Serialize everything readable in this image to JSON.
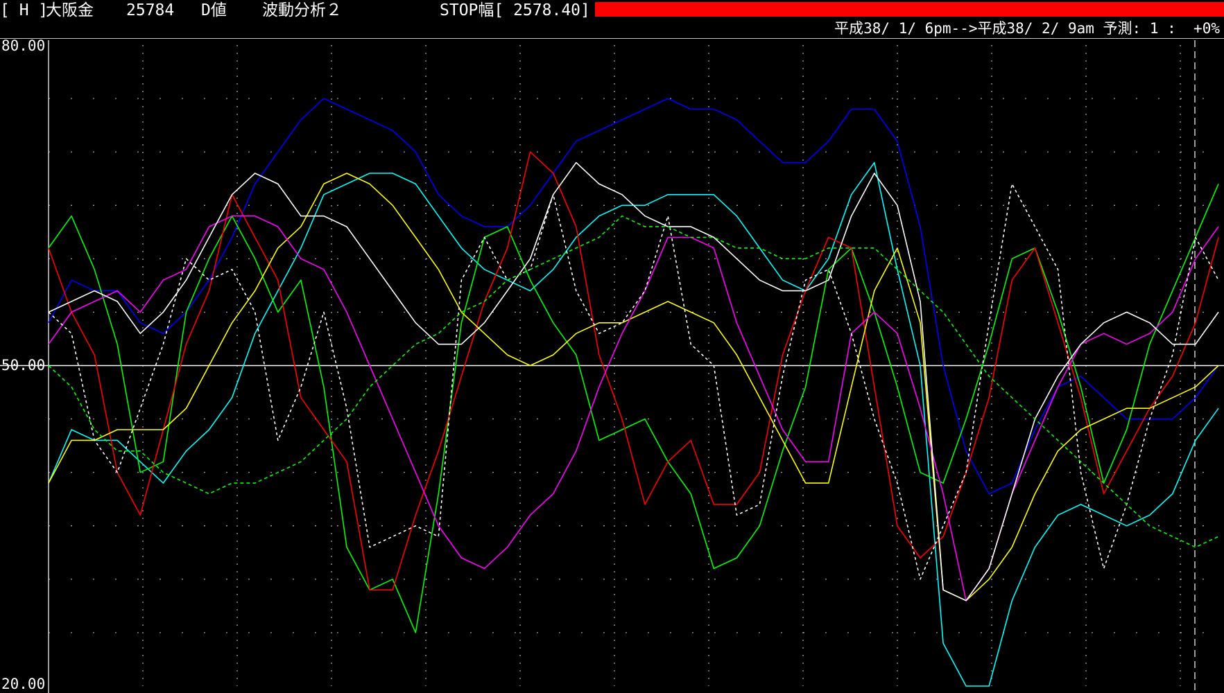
{
  "header": {
    "symbol_code": "[ H ]",
    "instrument": "大阪金",
    "price": "25784",
    "value_type": "D値",
    "analysis": "波動分析２",
    "stop_label": "STOP幅[ 2578.40]",
    "stop_bar_color": "#ff0000",
    "period": "平成38/ 1/ 6pm-->平成38/ 2/ 9am 予測: 1 :  +0%"
  },
  "chart_data": {
    "type": "line",
    "ylim": [
      20,
      80
    ],
    "ticks": [
      "80.00",
      "50.00",
      "20.00"
    ],
    "midline": 50,
    "grid": "dotted",
    "x": [
      0,
      1,
      2,
      3,
      4,
      5,
      6,
      7,
      8,
      9,
      10,
      11,
      12,
      13,
      14,
      15,
      16,
      17,
      18,
      19,
      20,
      21,
      22,
      23,
      24,
      25,
      26,
      27,
      28,
      29,
      30,
      31,
      32,
      33,
      34,
      35,
      36,
      37,
      38,
      39,
      40,
      41,
      42,
      43,
      44,
      45,
      46,
      47,
      48,
      49,
      50,
      51
    ],
    "series": [
      {
        "color": "#0000ff",
        "style": "solid",
        "values": [
          54,
          58,
          57,
          57,
          54,
          53,
          55,
          58,
          62,
          67,
          70,
          73,
          75,
          74,
          73,
          72,
          70,
          66,
          64,
          63,
          63,
          65,
          68,
          71,
          72,
          73,
          74,
          75,
          74,
          74,
          73,
          71,
          69,
          69,
          71,
          74,
          74,
          71,
          63,
          50,
          42,
          38,
          39,
          44,
          48,
          49,
          47,
          45,
          45,
          45,
          47,
          50
        ]
      },
      {
        "color": "#00ffff",
        "style": "solid",
        "values": [
          39,
          44,
          43,
          43,
          41,
          39,
          42,
          44,
          47,
          53,
          57,
          61,
          66,
          67,
          68,
          68,
          67,
          64,
          61,
          59,
          58,
          57,
          59,
          62,
          64,
          65,
          65,
          66,
          66,
          66,
          64,
          61,
          58,
          57,
          60,
          66,
          69,
          59,
          50,
          24,
          20,
          20,
          28,
          33,
          36,
          37,
          36,
          35,
          36,
          38,
          43,
          46
        ]
      },
      {
        "color": "#00ff00",
        "style": "solid",
        "values": [
          61,
          64,
          59,
          52,
          40,
          41,
          55,
          60,
          64,
          60,
          55,
          58,
          48,
          33,
          29,
          30,
          25,
          38,
          54,
          62,
          63,
          58,
          54,
          51,
          43,
          44,
          45,
          41,
          38,
          31,
          32,
          35,
          42,
          48,
          59,
          61,
          55,
          48,
          40,
          39,
          45,
          52,
          60,
          61,
          55,
          48,
          39,
          44,
          52,
          57,
          62,
          67
        ]
      },
      {
        "color": "#ff0000",
        "style": "solid",
        "values": [
          61,
          55,
          51,
          40,
          36,
          44,
          52,
          57,
          66,
          62,
          58,
          47,
          44,
          41,
          29,
          29,
          36,
          42,
          49,
          56,
          61,
          70,
          68,
          63,
          51,
          45,
          37,
          41,
          43,
          37,
          37,
          40,
          51,
          57,
          62,
          61,
          48,
          35,
          32,
          34,
          40,
          47,
          58,
          61,
          54,
          47,
          38,
          42,
          46,
          49,
          54,
          62
        ]
      },
      {
        "color": "#ffff00",
        "style": "solid",
        "values": [
          39,
          43,
          43,
          44,
          44,
          44,
          46,
          50,
          54,
          57,
          61,
          63,
          67,
          68,
          67,
          65,
          62,
          59,
          55,
          53,
          51,
          50,
          51,
          53,
          54,
          54,
          55,
          56,
          55,
          54,
          51,
          47,
          43,
          39,
          39,
          48,
          57,
          61,
          54,
          29,
          28,
          30,
          33,
          38,
          42,
          44,
          45,
          46,
          46,
          47,
          48,
          50
        ]
      },
      {
        "color": "#ff00ff",
        "style": "solid",
        "values": [
          52,
          55,
          56,
          57,
          55,
          58,
          59,
          63,
          64,
          64,
          63,
          60,
          59,
          55,
          50,
          45,
          40,
          35,
          32,
          31,
          33,
          36,
          38,
          42,
          48,
          53,
          57,
          62,
          62,
          61,
          54,
          49,
          44,
          41,
          41,
          53,
          55,
          53,
          46,
          38,
          28,
          31,
          38,
          43,
          48,
          52,
          53,
          52,
          53,
          55,
          60,
          63
        ]
      },
      {
        "color": "#ffffff",
        "style": "solid",
        "values": [
          55,
          56,
          57,
          56,
          53,
          55,
          58,
          62,
          66,
          68,
          67,
          64,
          64,
          63,
          60,
          57,
          54,
          52,
          52,
          54,
          57,
          60,
          66,
          69,
          67,
          66,
          64,
          63,
          63,
          62,
          60,
          58,
          57,
          57,
          58,
          64,
          68,
          65,
          56,
          29,
          28,
          31,
          38,
          45,
          49,
          52,
          54,
          55,
          54,
          52,
          52,
          55
        ]
      },
      {
        "color": "#ffffff",
        "style": "dotted",
        "values": [
          55,
          53,
          43,
          40,
          46,
          52,
          60,
          58,
          59,
          55,
          43,
          48,
          55,
          46,
          33,
          34,
          35,
          34,
          58,
          62,
          58,
          59,
          66,
          57,
          53,
          54,
          57,
          64,
          52,
          50,
          36,
          37,
          49,
          58,
          59,
          53,
          45,
          39,
          30,
          35,
          40,
          54,
          67,
          63,
          59,
          40,
          31,
          37,
          45,
          51,
          62,
          58
        ]
      },
      {
        "color": "#00ff00",
        "style": "dashed",
        "values": [
          50,
          48,
          44,
          42,
          42,
          40,
          39,
          38,
          39,
          39,
          40,
          41,
          43,
          45,
          48,
          50,
          52,
          53,
          55,
          56,
          58,
          59,
          60,
          61,
          62,
          64,
          63,
          63,
          62,
          62,
          61,
          61,
          60,
          60,
          61,
          61,
          61,
          59,
          57,
          55,
          52,
          49,
          47,
          45,
          43,
          41,
          39,
          37,
          35,
          34,
          33,
          34
        ]
      }
    ]
  }
}
